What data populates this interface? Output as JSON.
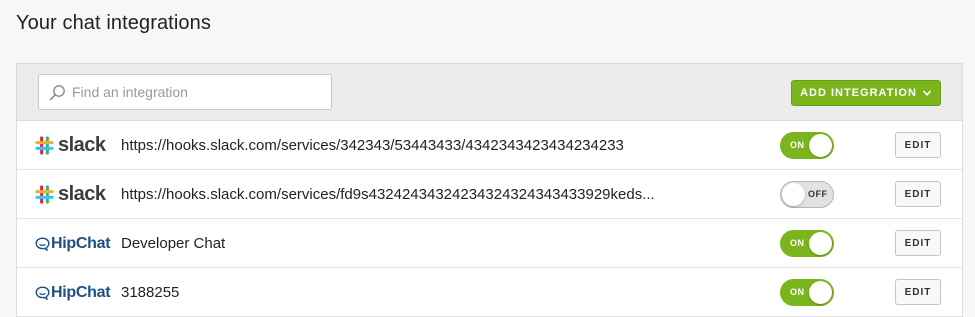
{
  "page": {
    "title": "Your chat integrations"
  },
  "toolbar": {
    "search_placeholder": "Find an integration",
    "add_button_label": "ADD INTEGRATION"
  },
  "colors": {
    "accent_green": "#7ab51d",
    "hipchat_blue": "#205081"
  },
  "integrations": [
    {
      "service": "slack",
      "logo_text": "slack",
      "url": "https://hooks.slack.com/services/342343/53443433/4342343423434234233",
      "enabled": true,
      "toggle_label": "ON",
      "edit_label": "EDIT"
    },
    {
      "service": "slack",
      "logo_text": "slack",
      "url": "https://hooks.slack.com/services/fd9s4324243432423432432434343392​9keds...",
      "enabled": false,
      "toggle_label": "OFF",
      "edit_label": "EDIT"
    },
    {
      "service": "hipchat",
      "logo_text": "HipChat",
      "url": "Developer Chat",
      "enabled": true,
      "toggle_label": "ON",
      "edit_label": "EDIT"
    },
    {
      "service": "hipchat",
      "logo_text": "HipChat",
      "url": "3188255",
      "enabled": true,
      "toggle_label": "ON",
      "edit_label": "EDIT"
    }
  ]
}
